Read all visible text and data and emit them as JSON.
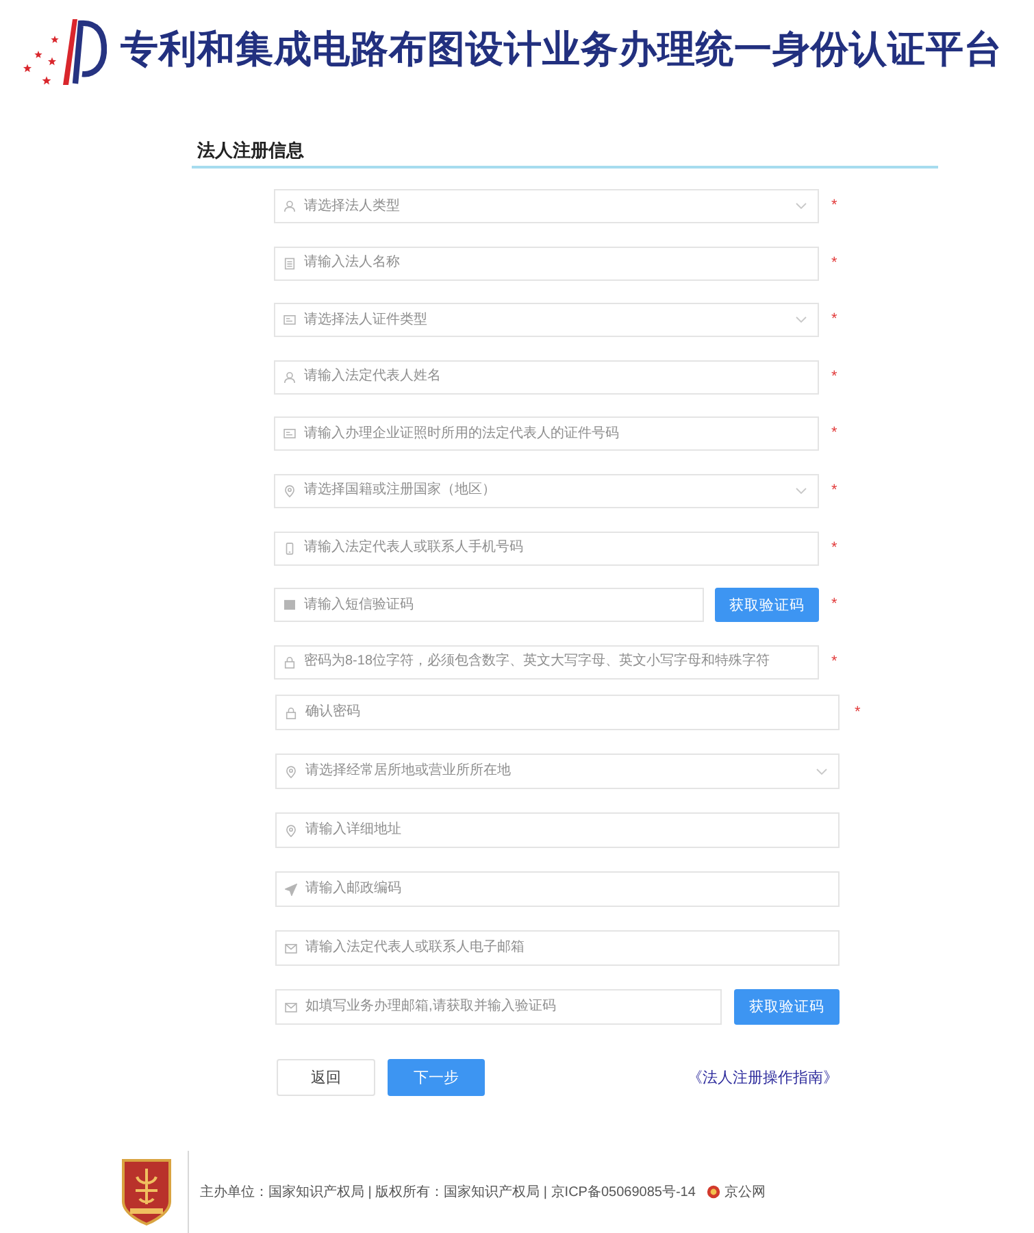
{
  "header": {
    "title": "专利和集成电路布图设计业务办理统一身份认证平台"
  },
  "form": {
    "heading": "法人注册信息",
    "sections": [
      {
        "fields": [
          {
            "kind": "select",
            "placeholder": "请选择法人类型",
            "mark": "*"
          },
          {
            "kind": "text",
            "placeholder": "请输入法人名称",
            "mark": "*"
          },
          {
            "kind": "select",
            "placeholder": "请选择法人证件类型",
            "mark": "*"
          },
          {
            "kind": "text",
            "placeholder": "请输入法定代表人姓名",
            "mark": "*"
          },
          {
            "kind": "text",
            "placeholder": "请输入办理企业证照时所用的法定代表人的证件号码",
            "mark": "*"
          },
          {
            "kind": "select",
            "placeholder": "请选择国籍或注册国家（地区）",
            "mark": "*"
          },
          {
            "kind": "text",
            "placeholder": "请输入法定代表人或联系人手机号码",
            "mark": "*"
          },
          {
            "kind": "code",
            "placeholder": "请输入短信验证码",
            "button": "获取验证码",
            "mark": "*"
          },
          {
            "kind": "password",
            "placeholder": "密码为8-18位字符，必须包含数字、英文大写字母、英文小写字母和特殊字符",
            "mark": "*"
          }
        ]
      },
      {
        "fields": [
          {
            "kind": "password",
            "placeholder": "确认密码",
            "mark": "*"
          },
          {
            "kind": "select",
            "placeholder": "请选择经常居所地或营业所所在地"
          },
          {
            "kind": "text",
            "placeholder": "请输入详细地址"
          },
          {
            "kind": "text",
            "placeholder": "请输入邮政编码"
          },
          {
            "kind": "text",
            "placeholder": "请输入法定代表人或联系人电子邮箱"
          },
          {
            "kind": "code",
            "placeholder": "如填写业务办理邮箱,请获取并输入验证码",
            "button": "获取验证码"
          }
        ]
      }
    ],
    "buttons": [
      {
        "kind": "secondary",
        "label": "返回"
      },
      {
        "kind": "primary",
        "label": "下一步"
      }
    ],
    "guide_link": "《法人注册操作指南》"
  },
  "footer": {
    "text": "主办单位：国家知识产权局 | 版权所有：国家知识产权局 | 京ICP备05069085号-14",
    "police_record": "京公网"
  }
}
